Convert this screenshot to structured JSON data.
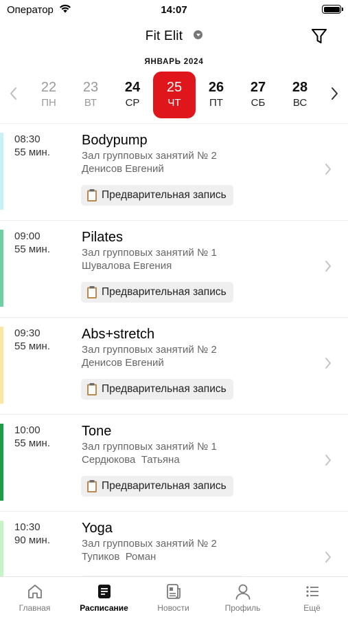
{
  "status_bar": {
    "carrier": "Оператор",
    "time": "14:07"
  },
  "header": {
    "gym_name": "Fit Elit"
  },
  "calendar": {
    "month": "ЯНВАРЬ 2024",
    "days": [
      {
        "num": "22",
        "wd": "ПН",
        "state": "past"
      },
      {
        "num": "23",
        "wd": "ВТ",
        "state": "past"
      },
      {
        "num": "24",
        "wd": "СР",
        "state": "future"
      },
      {
        "num": "25",
        "wd": "ЧТ",
        "state": "selected"
      },
      {
        "num": "26",
        "wd": "ПТ",
        "state": "future"
      },
      {
        "num": "27",
        "wd": "СБ",
        "state": "future"
      },
      {
        "num": "28",
        "wd": "ВС",
        "state": "future"
      }
    ],
    "accent_color": "#e0161d"
  },
  "classes": [
    {
      "time": "08:30",
      "duration": "55 мин.",
      "title": "Bodypump",
      "hall": "Зал групповых занятий № 2",
      "trainer": "Денисов Евгений",
      "badge": "Предварительная запись",
      "color": "#c9f1f6"
    },
    {
      "time": "09:00",
      "duration": "55 мин.",
      "title": "Pilates",
      "hall": "Зал групповых занятий № 1",
      "trainer": "Шувалова Евгения",
      "badge": "Предварительная запись",
      "color": "#6fcfa2"
    },
    {
      "time": "09:30",
      "duration": "55 мин.",
      "title": "Abs+stretch",
      "hall": "Зал групповых занятий № 2",
      "trainer": "Денисов Евгений",
      "badge": "Предварительная запись",
      "color": "#fbe7a1"
    },
    {
      "time": "10:00",
      "duration": "55 мин.",
      "title": "Tone",
      "hall": "Зал групповых занятий № 1",
      "trainer": "Сердюкова  Татьяна",
      "badge": "Предварительная запись",
      "color": "#1a9e48"
    },
    {
      "time": "10:30",
      "duration": "90 мин.",
      "title": "Yoga",
      "hall": "Зал групповых занятий № 2",
      "trainer": "Тупиков  Роман",
      "badge": "",
      "color": "#c6f4c6"
    }
  ],
  "tabbar": {
    "tabs": [
      {
        "label": "Главная",
        "icon": "home-icon"
      },
      {
        "label": "Расписание",
        "icon": "schedule-icon"
      },
      {
        "label": "Новости",
        "icon": "news-icon"
      },
      {
        "label": "Профиль",
        "icon": "profile-icon"
      },
      {
        "label": "Ещё",
        "icon": "more-icon"
      }
    ],
    "active": "Расписание"
  }
}
